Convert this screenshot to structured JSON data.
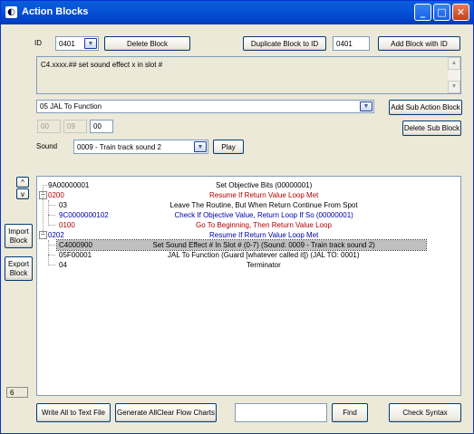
{
  "window": {
    "title": "Action Blocks",
    "icon": "app-icon",
    "controls": {
      "minimize": "_",
      "maximize": "□",
      "close": "✕"
    }
  },
  "top": {
    "id_label": "ID",
    "id_select": "0401",
    "delete_block": "Delete Block",
    "duplicate_block": "Duplicate Block to ID",
    "duplicate_target": "0401",
    "add_block": "Add Block with ID"
  },
  "description": "C4.xxxx.## set sound effect x in slot #",
  "action": {
    "selected": "05 JAL To Function",
    "add_sub": "Add Sub Action Block",
    "delete_sub": "Delete Sub Block",
    "params": [
      "00",
      "09",
      "00"
    ]
  },
  "sound": {
    "label": "Sound",
    "selected": "0009 - Train track sound 2",
    "play": "Play"
  },
  "side": {
    "up": "^",
    "down": "v",
    "import": [
      "Import",
      "Block"
    ],
    "export": [
      "Export",
      "Block"
    ],
    "count": "6"
  },
  "tree_colors": {
    "red": "#b20000",
    "blue": "#0000a8",
    "black": "#000000"
  },
  "tree": [
    {
      "code": "9A00000001",
      "desc": "Set Objective Bits (00000001)",
      "color": "black",
      "level": 0
    },
    {
      "code": "0200",
      "desc": "Resume If Return Value Loop Met",
      "color": "red",
      "level": 0,
      "expander": "−"
    },
    {
      "code": "03",
      "desc": "Leave The Routine, But When Return Continue From Spot",
      "color": "black",
      "level": 1
    },
    {
      "code": "9C0000000102",
      "desc": "Check If Objective Value, Return Loop If So (00000001)",
      "color": "blue",
      "level": 1
    },
    {
      "code": "0100",
      "desc": "Go To Beginning, Then Return Value Loop",
      "color": "red",
      "level": 1
    },
    {
      "code": "0202",
      "desc": "Resume If Return Value Loop Met",
      "color": "blue",
      "level": 0,
      "expander": "−"
    },
    {
      "code": "C4000900",
      "desc": "Set Sound Effect # In Slot # (0-7) (Sound: 0009 - Train track sound 2)",
      "color": "black",
      "level": 1,
      "selected": true
    },
    {
      "code": "05F00001",
      "desc": "JAL To Function (Guard [whatever called it]) (JAL TO: 0001)",
      "color": "black",
      "level": 1
    },
    {
      "code": "04",
      "desc": "Terminator",
      "color": "black",
      "level": 1
    }
  ],
  "bottom": {
    "write_all": "Write All to Text File",
    "generate": "Generate AllClear Flow Charts",
    "search_value": "",
    "find": "Find",
    "check_syntax": "Check Syntax"
  }
}
